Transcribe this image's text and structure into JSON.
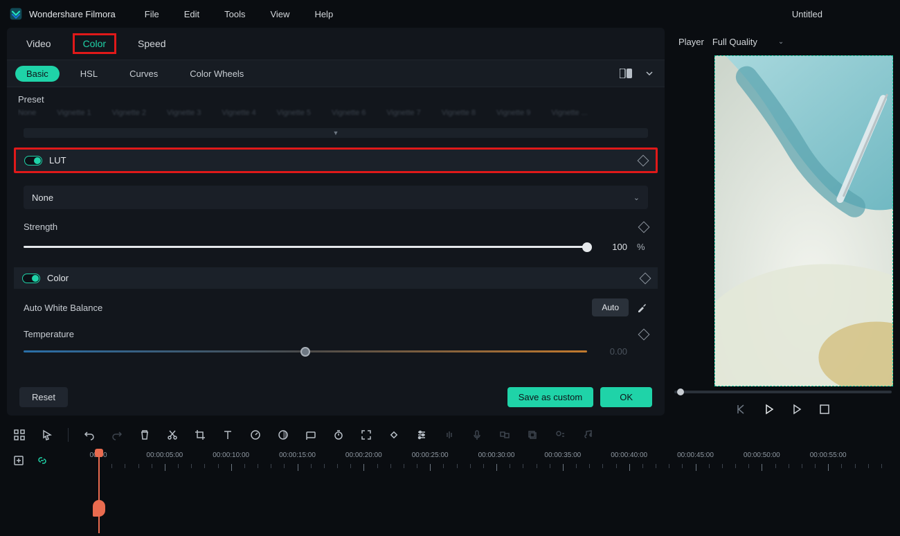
{
  "app": {
    "name": "Wondershare Filmora",
    "document": "Untitled"
  },
  "menu": {
    "file": "File",
    "edit": "Edit",
    "tools": "Tools",
    "view": "View",
    "help": "Help"
  },
  "primary_tabs": {
    "video": "Video",
    "color": "Color",
    "speed": "Speed"
  },
  "sub_tabs": {
    "basic": "Basic",
    "hsl": "HSL",
    "curves": "Curves",
    "wheels": "Color Wheels"
  },
  "preset": {
    "label": "Preset"
  },
  "lut": {
    "label": "LUT",
    "dropdown": "None",
    "strength_label": "Strength",
    "strength_value": "100",
    "strength_unit": "%"
  },
  "color": {
    "label": "Color",
    "awb_label": "Auto White Balance",
    "auto_btn": "Auto",
    "temperature_label": "Temperature",
    "temperature_value": "0.00"
  },
  "footer": {
    "reset": "Reset",
    "save": "Save as custom",
    "ok": "OK"
  },
  "player": {
    "label": "Player",
    "quality": "Full Quality"
  },
  "timeline": {
    "marks": [
      "00:00",
      "00:00:05:00",
      "00:00:10:00",
      "00:00:15:00",
      "00:00:20:00",
      "00:00:25:00",
      "00:00:30:00",
      "00:00:35:00",
      "00:00:40:00",
      "00:00:45:00",
      "00:00:50:00",
      "00:00:55:00"
    ]
  }
}
